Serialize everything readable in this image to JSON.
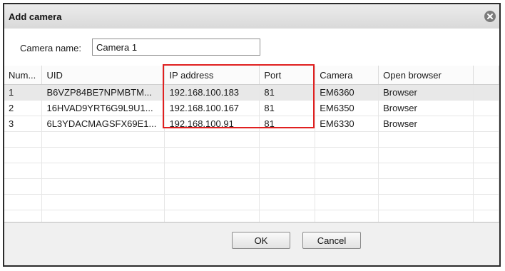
{
  "dialog": {
    "title": "Add camera",
    "close_icon": "close-circle-icon"
  },
  "form": {
    "camera_name_label": "Camera name:",
    "camera_name_value": "Camera 1"
  },
  "table": {
    "columns": [
      "Num...",
      "UID",
      "IP address",
      "Port",
      "Camera",
      "Open browser",
      ""
    ],
    "rows": [
      [
        "1",
        "B6VZP84BE7NPMBTM...",
        "192.168.100.183",
        "81",
        "EM6360",
        "Browser",
        ""
      ],
      [
        "2",
        "16HVAD9YRT6G9L9U1...",
        "192.168.100.167",
        "81",
        "EM6350",
        "Browser",
        ""
      ],
      [
        "3",
        "6L3YDACMAGSFX69E1...",
        "192.168.100.91",
        "81",
        "EM6330",
        "Browser",
        ""
      ]
    ],
    "selected_row": 0,
    "highlight_color": "#e02020"
  },
  "buttons": {
    "ok": "OK",
    "cancel": "Cancel"
  }
}
